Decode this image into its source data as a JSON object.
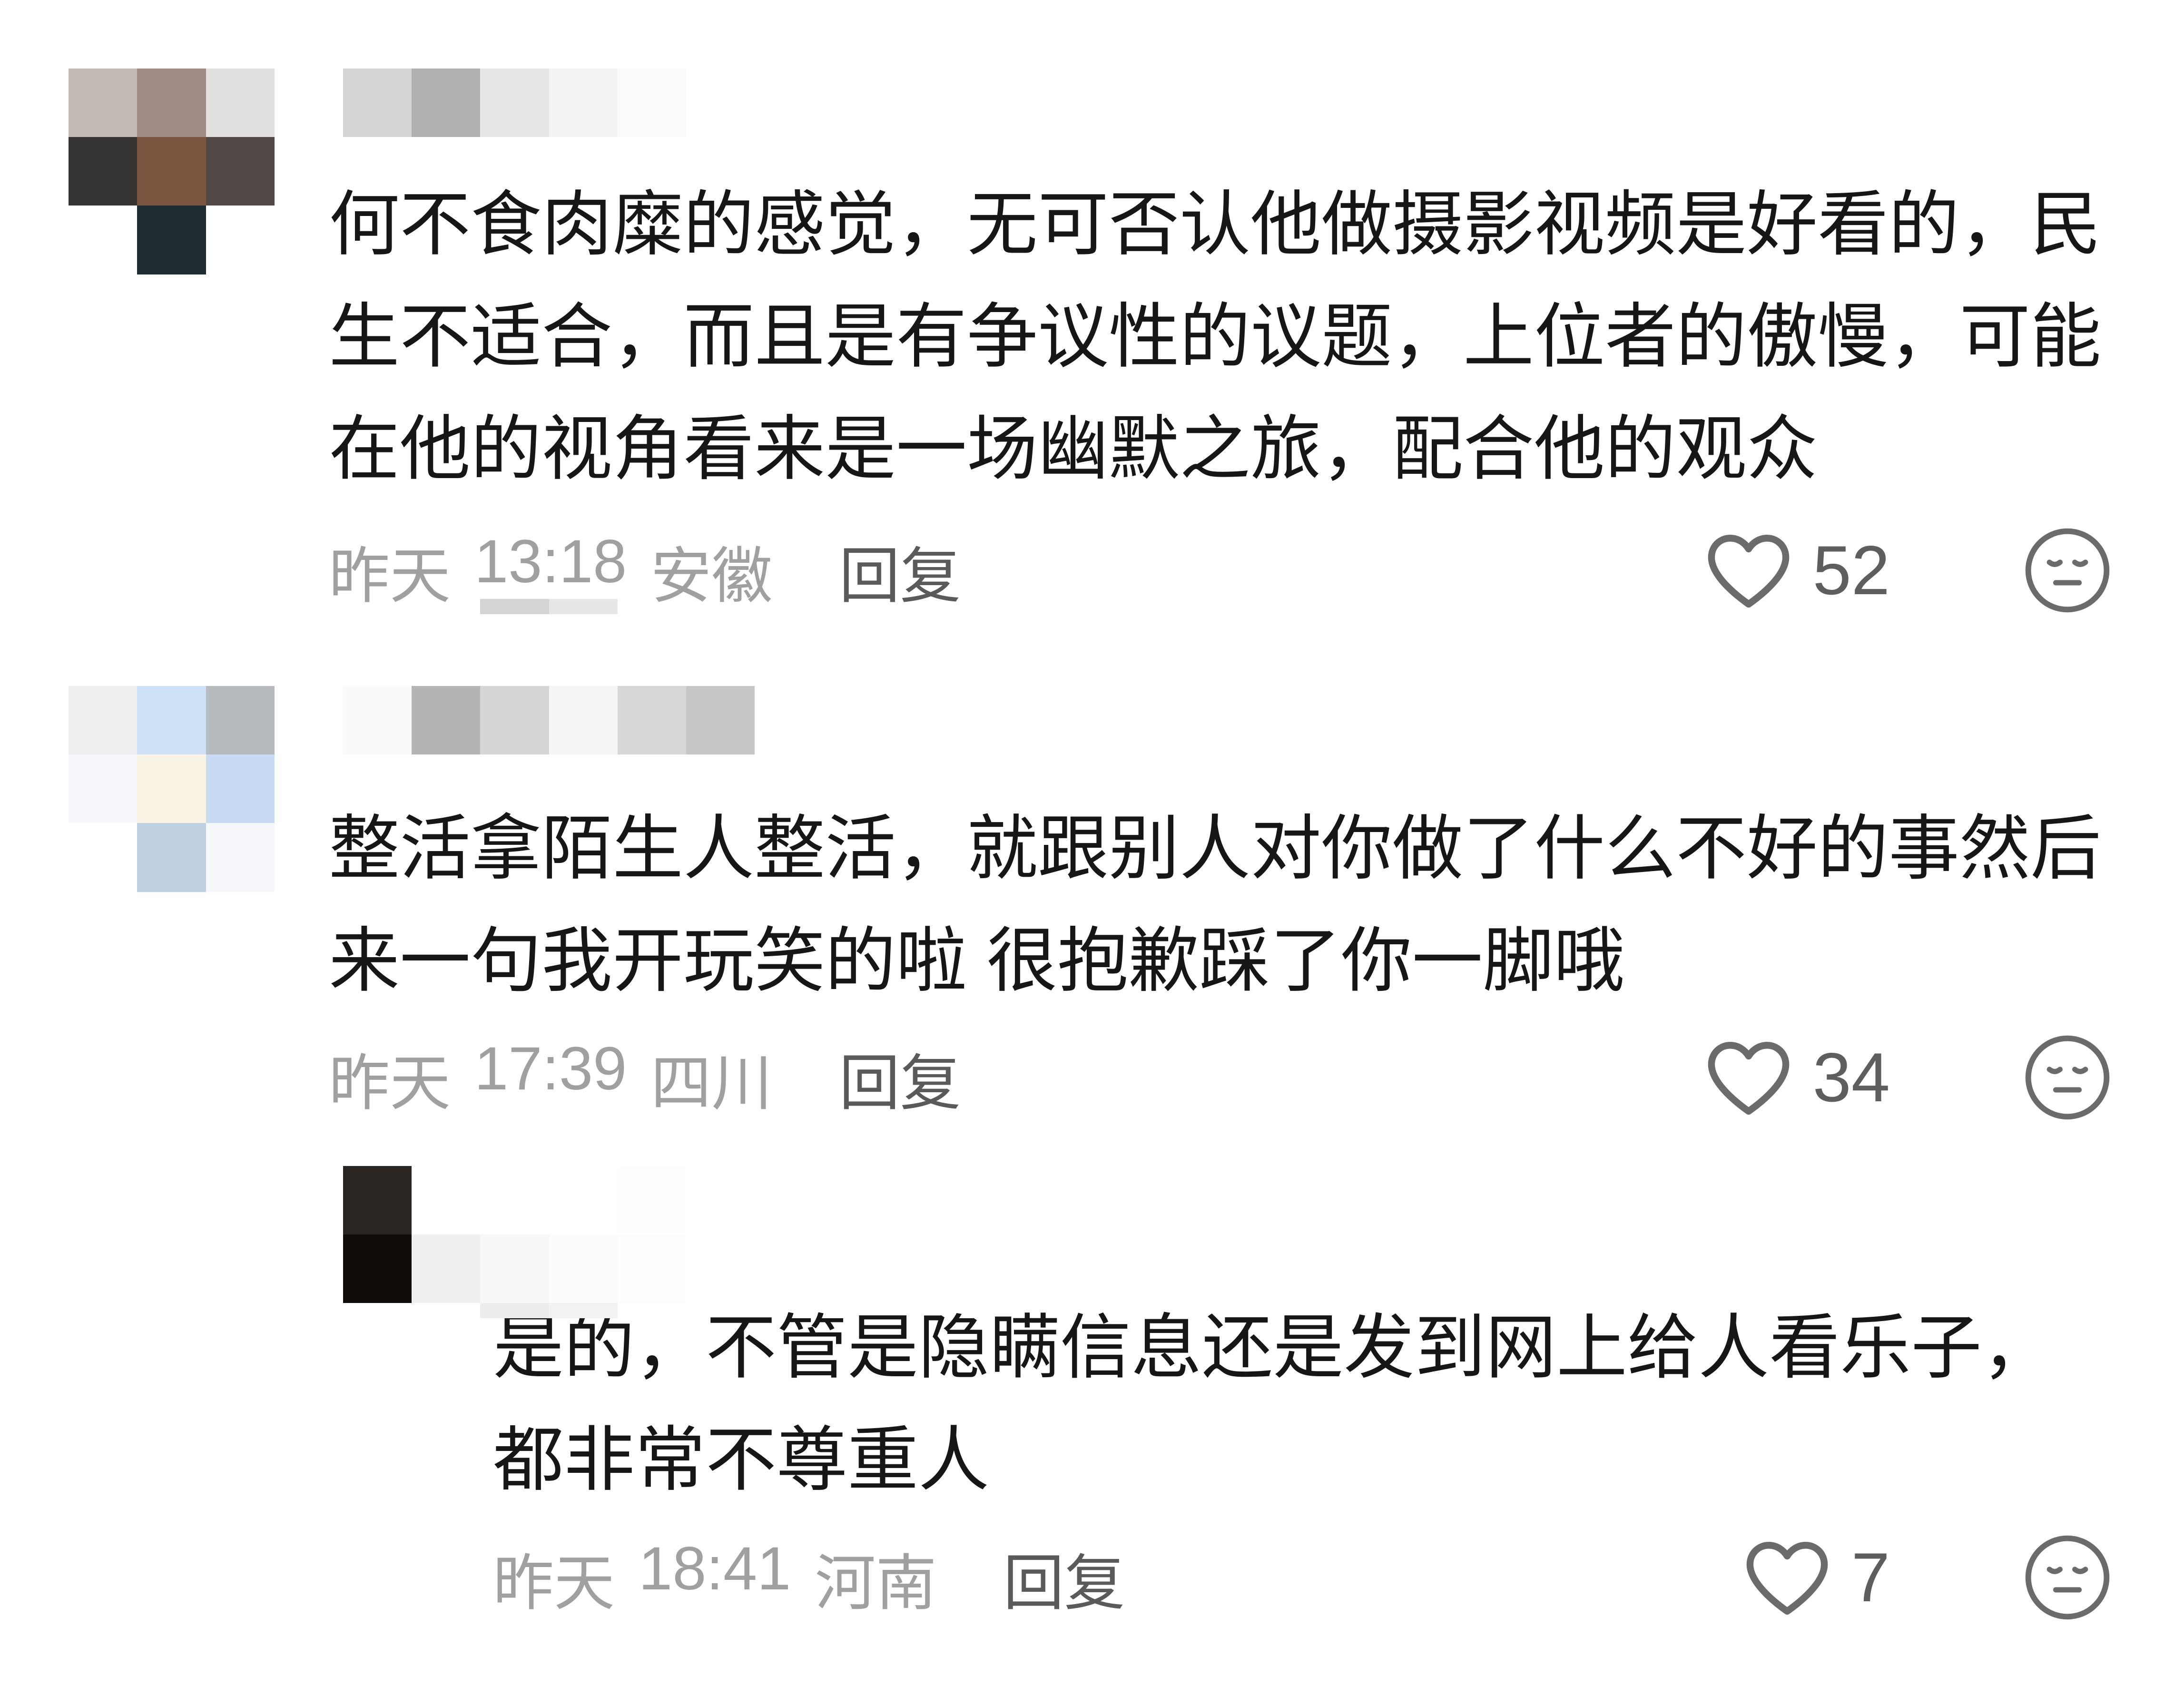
{
  "colors": {
    "background": "#ffffff",
    "text": "#161616",
    "meta": "#a0a0a0",
    "action": "#5a5a5a",
    "icon": "#6b6b6b",
    "count": "#5e5e5e"
  },
  "icons": {
    "like": "heart-icon",
    "dislike": "expressionless-face-icon"
  },
  "comments": [
    {
      "avatar_mosaic": [
        [
          "#c2b9b5",
          "#a08c84",
          "#e2e0df"
        ],
        [
          "#363433",
          "#7b5640",
          "#4f4845"
        ],
        [
          "#ffffff",
          "#1f2c31",
          "#ffffff"
        ]
      ],
      "username_mosaic": [
        [
          "#d5d5d5",
          "#b1b1b1",
          "#e5e5e5",
          "#f3f3f3",
          "#fbfbfb"
        ]
      ],
      "text_lines": [
        "何不食肉糜的感觉，无可否认他做摄影视频是好看的，民",
        "生不适合，而且是有争议性的议题，上位者的傲慢，可能",
        "在他的视角看来是一场幽默之旅，配合他的观众"
      ],
      "date": "昨天",
      "time": "13:18",
      "location": "安徽",
      "reply_label": "回复",
      "likes": 52
    },
    {
      "avatar_mosaic": [
        [
          "#efefef",
          "#cfe1f7",
          "#b7bbbf"
        ],
        [
          "#f7f8fc",
          "#f8f3e4",
          "#c9dbf3"
        ],
        [
          "#ffffff",
          "#c0d0e3",
          "#f5f7fa"
        ]
      ],
      "username_mosaic": [
        [
          "#fafafa",
          "#b4b4b4",
          "#d6d6d6",
          "#f5f5f5",
          "#d7d7d7",
          "#c7c7c7"
        ]
      ],
      "text_lines": [
        "整活拿陌生人整活，就跟别人对你做了什么不好的事然后",
        "来一句我开玩笑的啦 很抱歉踩了你一脚哦"
      ],
      "date": "昨天",
      "time": "17:39",
      "location": "四川",
      "reply_label": "回复",
      "likes": 34,
      "replies": [
        {
          "avatar_mosaic": [
            [
              "#2b2522",
              "#ffffff"
            ],
            [
              "#0f0c0a",
              "#efefef"
            ]
          ],
          "username_mosaic": [
            [
              "#ffffff",
              "#ffffff",
              "#fefefe"
            ],
            [
              "#f7f7f7",
              "#fbfbfb",
              "#fdfdfd"
            ]
          ],
          "text_lines": [
            "是的，不管是隐瞒信息还是发到网上给人看乐子，",
            "都非常不尊重人"
          ],
          "date": "昨天",
          "time": "18:41",
          "location": "河南",
          "reply_label": "回复",
          "likes": 7
        }
      ]
    }
  ]
}
